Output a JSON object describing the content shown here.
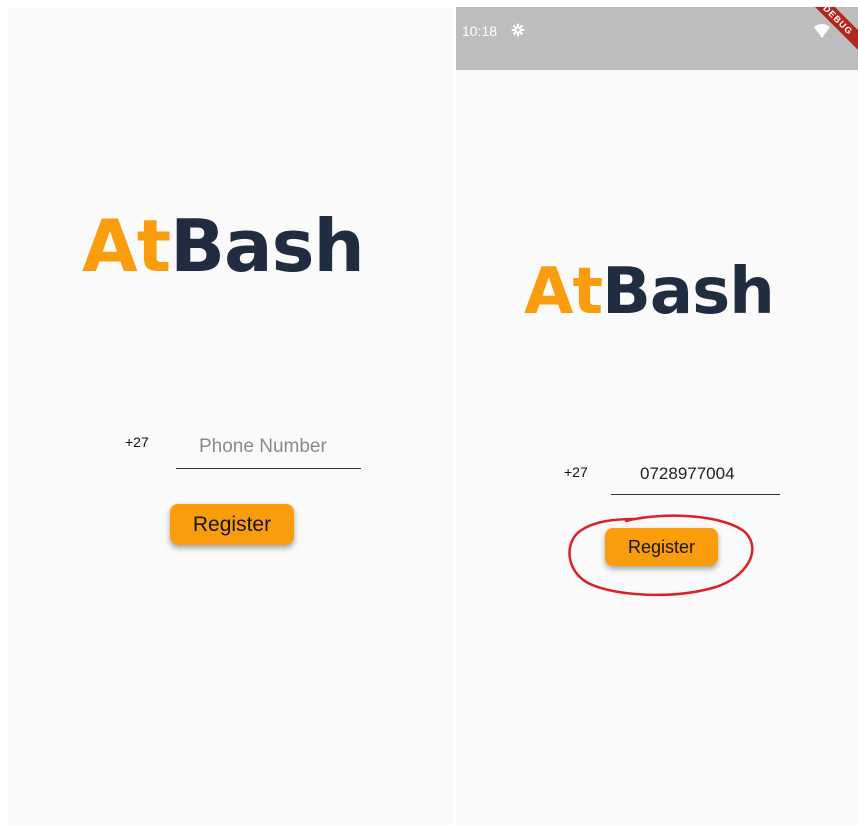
{
  "left_screen": {
    "logo": {
      "at": "At",
      "bash": "Bash"
    },
    "country_code": "+27",
    "phone_field": {
      "placeholder": "Phone Number",
      "value": ""
    },
    "register_label": "Register"
  },
  "right_screen": {
    "status_bar": {
      "time": "10:18",
      "debug_banner": "DEBUG"
    },
    "logo": {
      "at": "At",
      "bash": "Bash"
    },
    "country_code": "+27",
    "phone_field": {
      "placeholder": "Phone Number",
      "value": "0728977004"
    },
    "register_label": "Register"
  },
  "colors": {
    "accent": "#f99d0c",
    "logo_dark": "#202d40",
    "annotation": "#d92127",
    "status_bar": "#bdbdbd"
  },
  "icons": [
    "gear-icon",
    "wifi-icon"
  ]
}
